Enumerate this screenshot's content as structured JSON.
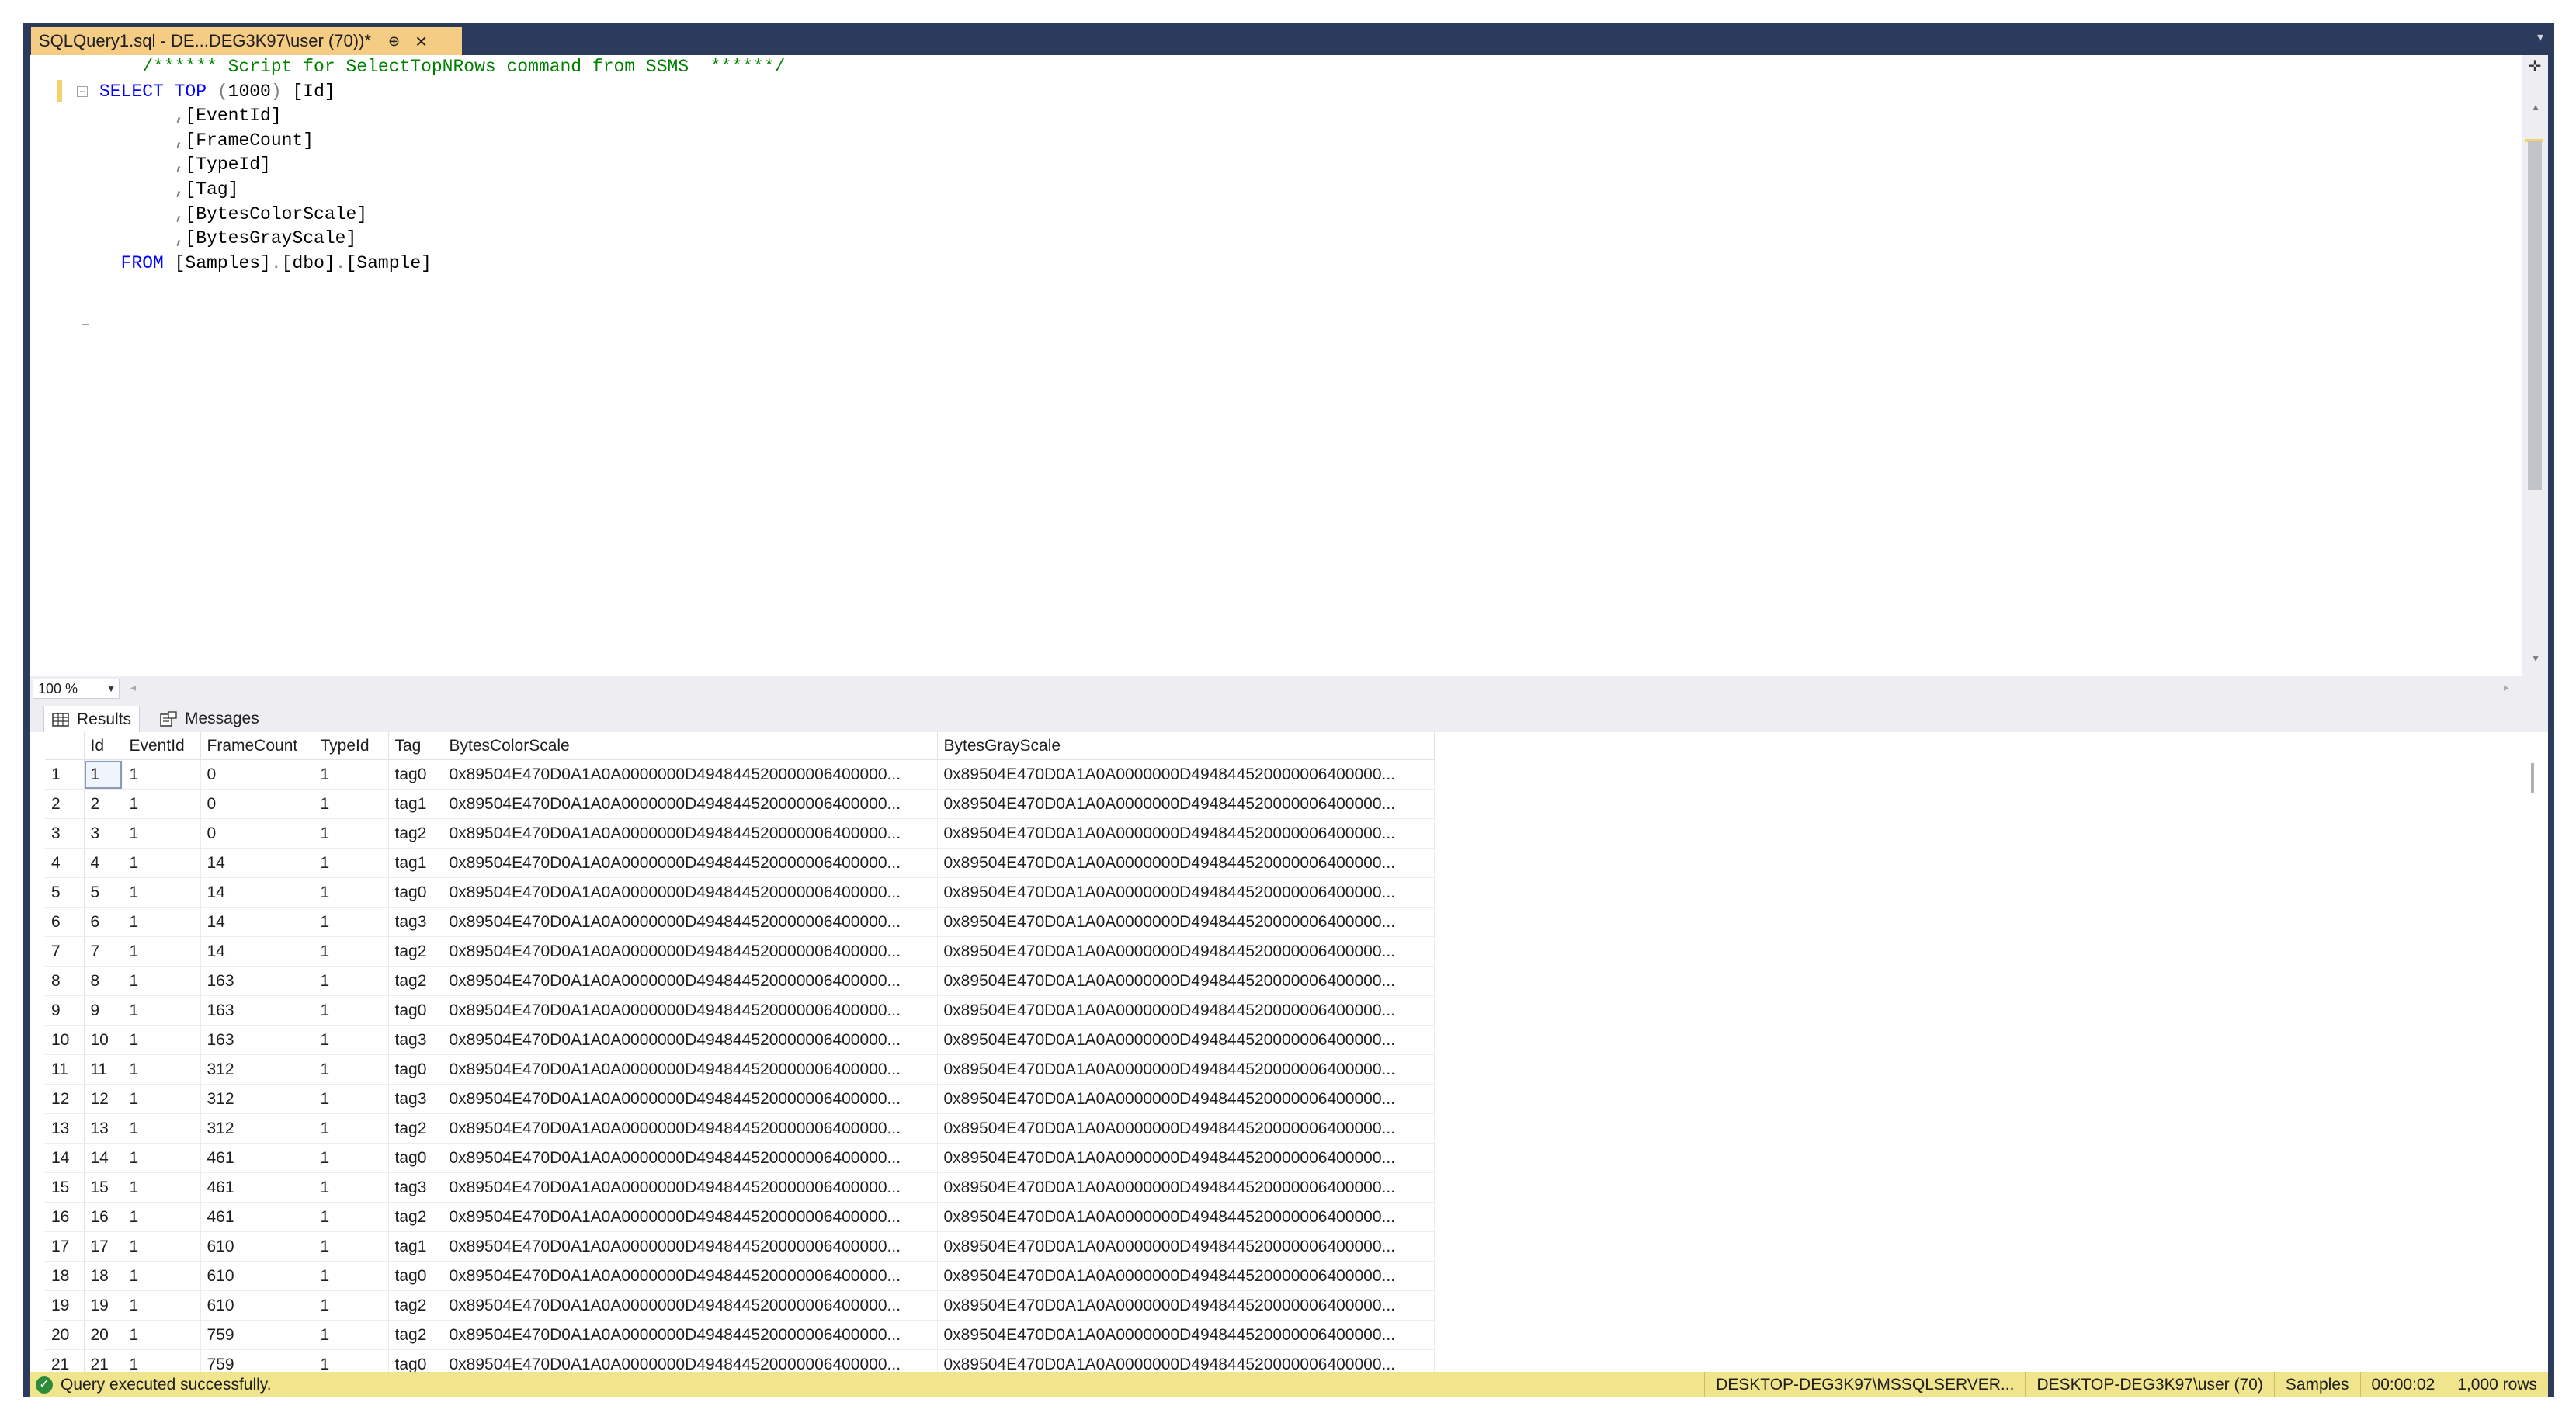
{
  "tab": {
    "title": "SQLQuery1.sql - DE...DEG3K97\\user (70))*",
    "pin": "⊕",
    "close": "×"
  },
  "editor": {
    "lines": [
      {
        "parts": [
          {
            "cls": "cm",
            "text": "    /****** Script for SelectTopNRows command from SSMS  ******/"
          }
        ]
      },
      {
        "parts": [
          {
            "cls": "kw",
            "text": "SELECT TOP "
          },
          {
            "cls": "op",
            "text": "("
          },
          {
            "cls": "",
            "text": "1000"
          },
          {
            "cls": "op",
            "text": ")"
          },
          {
            "cls": "",
            "text": " [Id]"
          }
        ]
      },
      {
        "parts": [
          {
            "cls": "op",
            "text": "       ,"
          },
          {
            "cls": "",
            "text": "[EventId]"
          }
        ]
      },
      {
        "parts": [
          {
            "cls": "op",
            "text": "       ,"
          },
          {
            "cls": "",
            "text": "[FrameCount]"
          }
        ]
      },
      {
        "parts": [
          {
            "cls": "op",
            "text": "       ,"
          },
          {
            "cls": "",
            "text": "[TypeId]"
          }
        ]
      },
      {
        "parts": [
          {
            "cls": "op",
            "text": "       ,"
          },
          {
            "cls": "",
            "text": "[Tag]"
          }
        ]
      },
      {
        "parts": [
          {
            "cls": "op",
            "text": "       ,"
          },
          {
            "cls": "",
            "text": "[BytesColorScale]"
          }
        ]
      },
      {
        "parts": [
          {
            "cls": "op",
            "text": "       ,"
          },
          {
            "cls": "",
            "text": "[BytesGrayScale]"
          }
        ]
      },
      {
        "parts": [
          {
            "cls": "kw",
            "text": "  FROM "
          },
          {
            "cls": "",
            "text": "[Samples]"
          },
          {
            "cls": "op",
            "text": "."
          },
          {
            "cls": "",
            "text": "[dbo]"
          },
          {
            "cls": "op",
            "text": "."
          },
          {
            "cls": "",
            "text": "[Sample]"
          }
        ]
      }
    ]
  },
  "zoom": {
    "value": "100 %"
  },
  "results_tabs": {
    "results_label": "Results",
    "messages_label": "Messages"
  },
  "grid": {
    "columns": [
      "",
      "Id",
      "EventId",
      "FrameCount",
      "TypeId",
      "Tag",
      "BytesColorScale",
      "BytesGrayScale"
    ],
    "rows": [
      [
        "1",
        "1",
        "1",
        "0",
        "1",
        "tag0",
        "0x89504E470D0A1A0A0000000D494844520000006400000...",
        "0x89504E470D0A1A0A0000000D494844520000006400000..."
      ],
      [
        "2",
        "2",
        "1",
        "0",
        "1",
        "tag1",
        "0x89504E470D0A1A0A0000000D494844520000006400000...",
        "0x89504E470D0A1A0A0000000D494844520000006400000..."
      ],
      [
        "3",
        "3",
        "1",
        "0",
        "1",
        "tag2",
        "0x89504E470D0A1A0A0000000D494844520000006400000...",
        "0x89504E470D0A1A0A0000000D494844520000006400000..."
      ],
      [
        "4",
        "4",
        "1",
        "14",
        "1",
        "tag1",
        "0x89504E470D0A1A0A0000000D494844520000006400000...",
        "0x89504E470D0A1A0A0000000D494844520000006400000..."
      ],
      [
        "5",
        "5",
        "1",
        "14",
        "1",
        "tag0",
        "0x89504E470D0A1A0A0000000D494844520000006400000...",
        "0x89504E470D0A1A0A0000000D494844520000006400000..."
      ],
      [
        "6",
        "6",
        "1",
        "14",
        "1",
        "tag3",
        "0x89504E470D0A1A0A0000000D494844520000006400000...",
        "0x89504E470D0A1A0A0000000D494844520000006400000..."
      ],
      [
        "7",
        "7",
        "1",
        "14",
        "1",
        "tag2",
        "0x89504E470D0A1A0A0000000D494844520000006400000...",
        "0x89504E470D0A1A0A0000000D494844520000006400000..."
      ],
      [
        "8",
        "8",
        "1",
        "163",
        "1",
        "tag2",
        "0x89504E470D0A1A0A0000000D494844520000006400000...",
        "0x89504E470D0A1A0A0000000D494844520000006400000..."
      ],
      [
        "9",
        "9",
        "1",
        "163",
        "1",
        "tag0",
        "0x89504E470D0A1A0A0000000D494844520000006400000...",
        "0x89504E470D0A1A0A0000000D494844520000006400000..."
      ],
      [
        "10",
        "10",
        "1",
        "163",
        "1",
        "tag3",
        "0x89504E470D0A1A0A0000000D494844520000006400000...",
        "0x89504E470D0A1A0A0000000D494844520000006400000..."
      ],
      [
        "11",
        "11",
        "1",
        "312",
        "1",
        "tag0",
        "0x89504E470D0A1A0A0000000D494844520000006400000...",
        "0x89504E470D0A1A0A0000000D494844520000006400000..."
      ],
      [
        "12",
        "12",
        "1",
        "312",
        "1",
        "tag3",
        "0x89504E470D0A1A0A0000000D494844520000006400000...",
        "0x89504E470D0A1A0A0000000D494844520000006400000..."
      ],
      [
        "13",
        "13",
        "1",
        "312",
        "1",
        "tag2",
        "0x89504E470D0A1A0A0000000D494844520000006400000...",
        "0x89504E470D0A1A0A0000000D494844520000006400000..."
      ],
      [
        "14",
        "14",
        "1",
        "461",
        "1",
        "tag0",
        "0x89504E470D0A1A0A0000000D494844520000006400000...",
        "0x89504E470D0A1A0A0000000D494844520000006400000..."
      ],
      [
        "15",
        "15",
        "1",
        "461",
        "1",
        "tag3",
        "0x89504E470D0A1A0A0000000D494844520000006400000...",
        "0x89504E470D0A1A0A0000000D494844520000006400000..."
      ],
      [
        "16",
        "16",
        "1",
        "461",
        "1",
        "tag2",
        "0x89504E470D0A1A0A0000000D494844520000006400000...",
        "0x89504E470D0A1A0A0000000D494844520000006400000..."
      ],
      [
        "17",
        "17",
        "1",
        "610",
        "1",
        "tag1",
        "0x89504E470D0A1A0A0000000D494844520000006400000...",
        "0x89504E470D0A1A0A0000000D494844520000006400000..."
      ],
      [
        "18",
        "18",
        "1",
        "610",
        "1",
        "tag0",
        "0x89504E470D0A1A0A0000000D494844520000006400000...",
        "0x89504E470D0A1A0A0000000D494844520000006400000..."
      ],
      [
        "19",
        "19",
        "1",
        "610",
        "1",
        "tag2",
        "0x89504E470D0A1A0A0000000D494844520000006400000...",
        "0x89504E470D0A1A0A0000000D494844520000006400000..."
      ],
      [
        "20",
        "20",
        "1",
        "759",
        "1",
        "tag2",
        "0x89504E470D0A1A0A0000000D494844520000006400000...",
        "0x89504E470D0A1A0A0000000D494844520000006400000..."
      ],
      [
        "21",
        "21",
        "1",
        "759",
        "1",
        "tag0",
        "0x89504E470D0A1A0A0000000D494844520000006400000...",
        "0x89504E470D0A1A0A0000000D494844520000006400000..."
      ]
    ]
  },
  "status": {
    "message": "Query executed successfully.",
    "server": "DESKTOP-DEG3K97\\MSSQLSERVER...",
    "user": "DESKTOP-DEG3K97\\user (70)",
    "database": "Samples",
    "elapsed": "00:00:02",
    "rows": "1,000 rows"
  },
  "colors": {
    "tab_active": "#f5cc84",
    "frame": "#2c3b5b",
    "statusbar": "#f0e58c",
    "keyword": "#0000ff",
    "comment": "#008000"
  }
}
